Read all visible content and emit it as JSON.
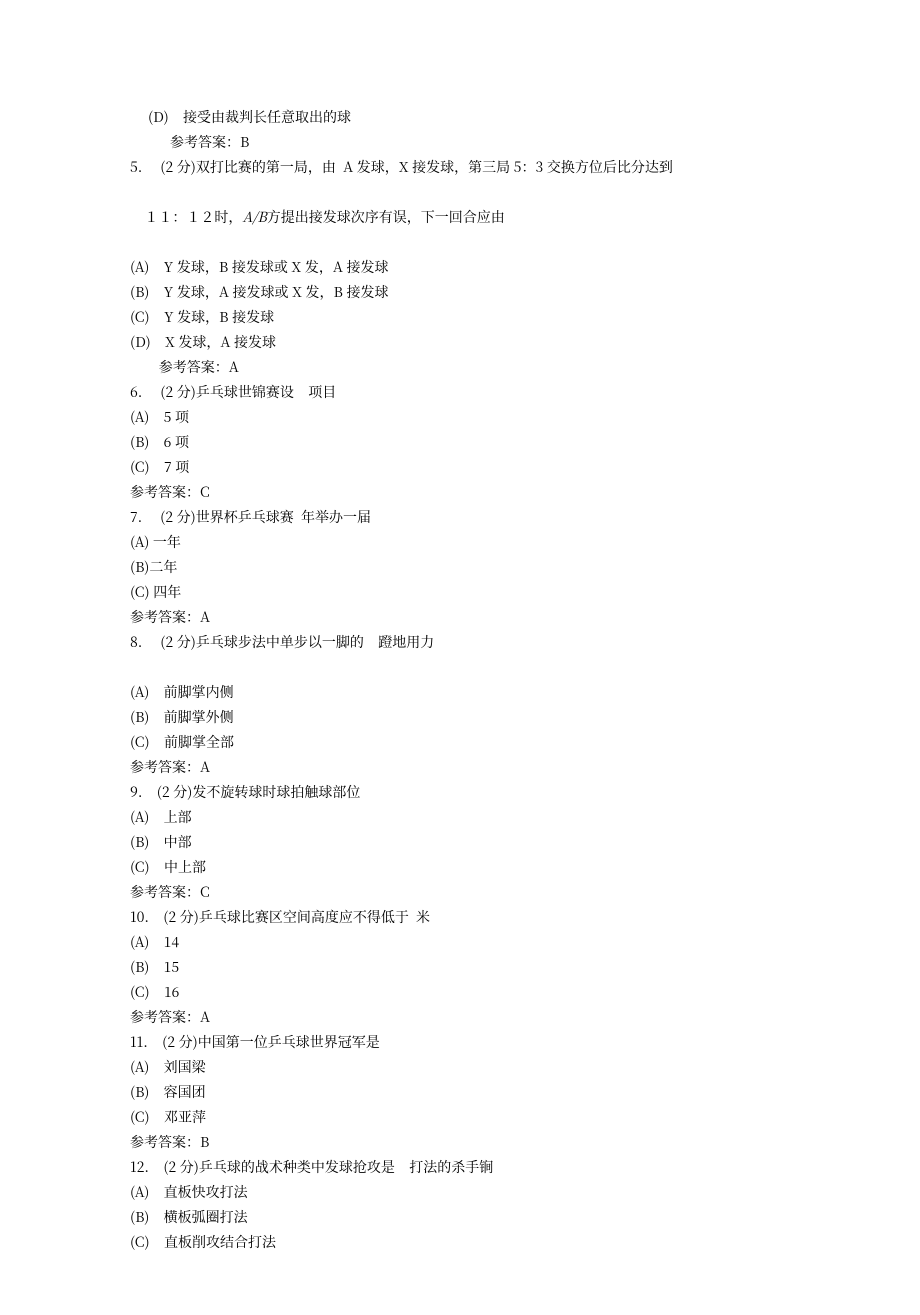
{
  "prevD": "(D)    接受由裁判长任意取出的球",
  "prevAns": "参考答案：B",
  "q5": {
    "stem": "5.     (2 分)双打比赛的第一局，由  A 发球，X 接发球，第三局 5：3 交换方位后比分达到",
    "stem2_a": "１１：１２时，",
    "stem2_b": "A/B",
    "stem2_c": "方提出接发球次序有误，下一回合应由",
    "A": "(A)    Y 发球，B 接发球或 X 发，A 接发球",
    "B": "(B)    Y 发球，A 接发球或 X 发，B 接发球",
    "C": "(C)    Y 发球，B 接发球",
    "D": "(D)    X 发球，A 接发球",
    "ans": "   参考答案：A"
  },
  "q6": {
    "stem": "6.     (2 分)乒乓球世锦赛设    项目",
    "A": "(A)    5 项",
    "B": "(B)    6 项",
    "C": "(C)    7 项",
    "ans": "参考答案：C"
  },
  "q7": {
    "stem": "7.     (2 分)世界杯乒乓球赛  年举办一届",
    "A": "(A) 一年",
    "B": "(B)二年",
    "C": "(C) 四年",
    "ans": "参考答案：A"
  },
  "q8": {
    "stem": "8.     (2 分)乒乓球步法中单步以一脚的    蹬地用力",
    "A": "(A)    前脚掌内侧",
    "B": "(B)    前脚掌外侧",
    "C": "(C)    前脚掌全部",
    "ans": "参考答案：A"
  },
  "q9": {
    "stem": "9.    (2 分)发不旋转球时球拍触球部位",
    "A": "(A)    上部",
    "B": "(B)    中部",
    "C": "(C)    中上部",
    "ans": "参考答案：C"
  },
  "q10": {
    "stem": "10.    (2 分)乒乓球比赛区空间高度应不得低于  米",
    "A": "(A)    14",
    "B": "(B)    15",
    "C": "(C)    16",
    "ans": "参考答案：A"
  },
  "q11": {
    "stem": "11.    (2 分)中国第一位乒乓球世界冠军是",
    "A": "(A)    刘国梁",
    "B": "(B)    容国团",
    "C": "(C)    邓亚萍",
    "ans": "参考答案：B"
  },
  "q12": {
    "stem": "12.    (2 分)乒乓球的战术种类中发球抢攻是    打法的杀手锏",
    "A": "(A)    直板快攻打法",
    "B": "(B)    横板弧圈打法",
    "C": "(C)    直板削攻结合打法"
  }
}
